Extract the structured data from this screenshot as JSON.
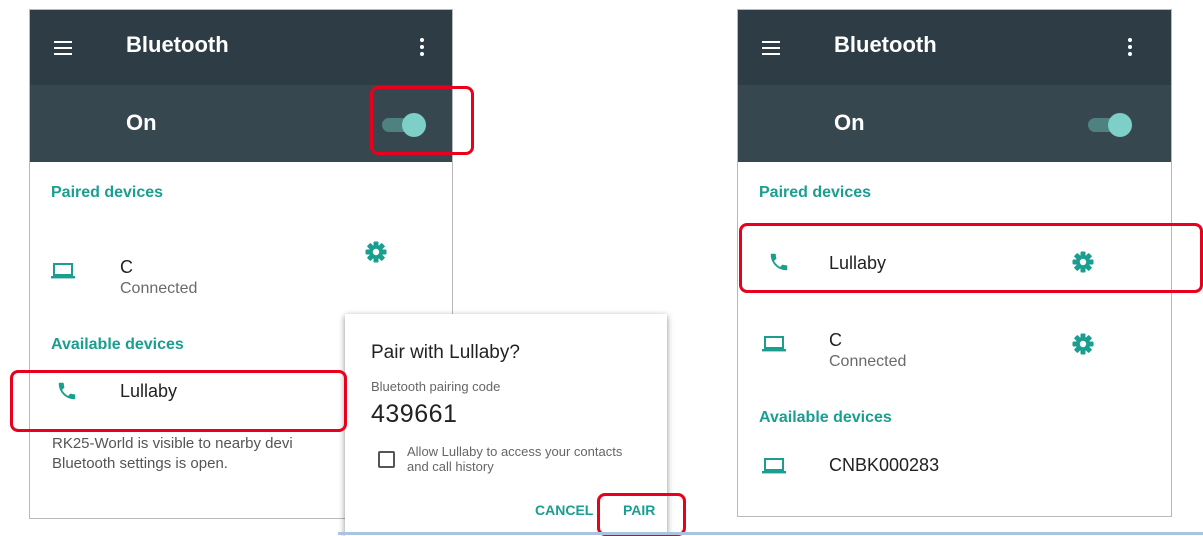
{
  "left_screen": {
    "title": "Bluetooth",
    "switch_label": "On",
    "paired_header": "Paired devices",
    "paired": [
      {
        "name": "C",
        "status": "Connected",
        "icon": "laptop-icon"
      }
    ],
    "available_header": "Available devices",
    "available": [
      {
        "name": "Lullaby",
        "icon": "phone-icon"
      }
    ],
    "footnote_line1": "RK25-World is visible to nearby devi",
    "footnote_line2": "Bluetooth settings is open."
  },
  "dialog": {
    "title": "Pair with Lullaby?",
    "code_label": "Bluetooth pairing code",
    "code": "439661",
    "checkbox_line1": "Allow Lullaby to access your contacts",
    "checkbox_line2": "and call history",
    "checkbox_checked": false,
    "cancel_label": "CANCEL",
    "pair_label": "PAIR"
  },
  "right_screen": {
    "title": "Bluetooth",
    "switch_label": "On",
    "paired_header": "Paired devices",
    "paired": [
      {
        "name": "Lullaby",
        "icon": "phone-icon"
      },
      {
        "name": "C",
        "status": "Connected",
        "icon": "laptop-icon"
      }
    ],
    "available_header": "Available devices",
    "available": [
      {
        "name": "CNBK000283",
        "icon": "laptop-icon"
      }
    ]
  },
  "colors": {
    "appbar": "#2e3d45",
    "switchbar": "#37474f",
    "accent": "#1a9e90",
    "highlight": "#e8001c"
  }
}
